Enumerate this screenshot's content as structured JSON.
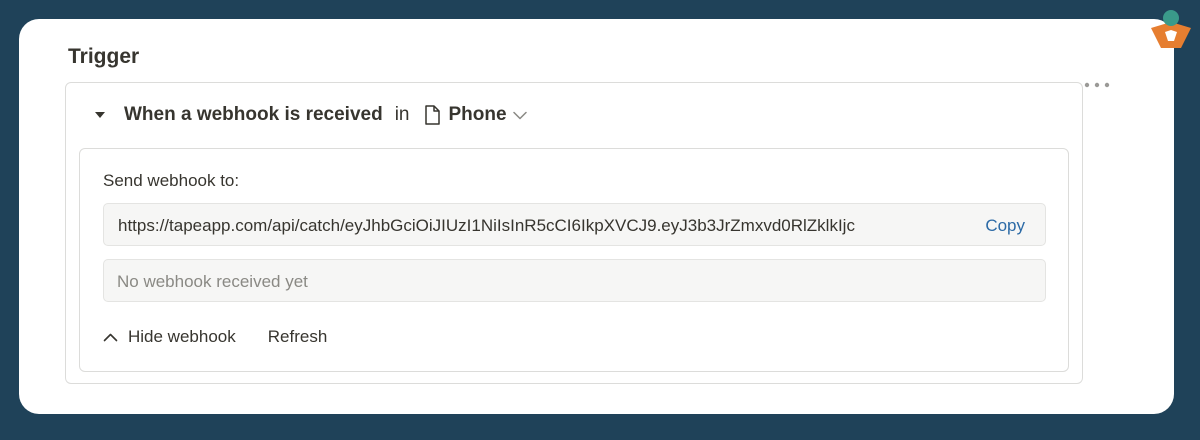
{
  "section": {
    "title": "Trigger"
  },
  "trigger": {
    "title": "When a webhook is received",
    "in_word": "in",
    "database": "Phone"
  },
  "webhook": {
    "send_label": "Send webhook to:",
    "url": "https://tapeapp.com/api/catch/eyJhbGciOiJIUzI1NiIsInR5cCI6IkpXVCJ9.eyJ3b3JrZmxvd0RlZklkIjc",
    "copy_label": "Copy",
    "status_text": "No webhook received yet",
    "hide_label": "Hide webhook",
    "refresh_label": "Refresh"
  },
  "icons": {
    "collapse": "caret-down-icon",
    "database": "document-icon",
    "dropdown": "chevron-down-icon",
    "more": "more-horizontal-icon",
    "hide": "chevron-up-icon",
    "logo": "brand-logo-icon"
  },
  "colors": {
    "background": "#1f4259",
    "link": "#2c6aa6",
    "text": "#37352f",
    "muted": "#8a8984",
    "logo_orange": "#e67e30",
    "logo_teal": "#3a9a8a"
  }
}
